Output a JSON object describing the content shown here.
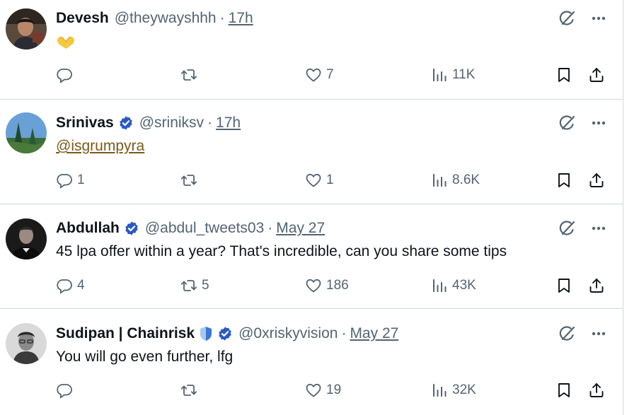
{
  "tweets": [
    {
      "name": "Devesh",
      "verified": false,
      "shield": false,
      "handle": "@theywayshhh",
      "separator": "·",
      "time": "17h",
      "text": "",
      "emoji": "heart-hands",
      "replies": "",
      "retweets": "",
      "likes": "7",
      "views": "11K"
    },
    {
      "name": "Srinivas",
      "verified": true,
      "shield": false,
      "handle": "@sriniksv",
      "separator": "·",
      "time": "17h",
      "mention": "@isgrumpyra",
      "replies": "1",
      "retweets": "",
      "likes": "1",
      "views": "8.6K"
    },
    {
      "name": "Abdullah",
      "verified": true,
      "shield": false,
      "handle": "@abdul_tweets03",
      "separator": "·",
      "time": "May 27",
      "text": "45 lpa offer within a year? That's incredible, can you share some tips",
      "replies": "4",
      "retweets": "5",
      "likes": "186",
      "views": "43K"
    },
    {
      "name": "Sudipan | Chainrisk",
      "verified": true,
      "shield": true,
      "handle": "@0xriskyvision",
      "separator": "·",
      "time": "May 27",
      "text": "You will go even further, lfg",
      "replies": "",
      "retweets": "",
      "likes": "19",
      "views": "32K"
    }
  ],
  "colors": {
    "text": "#0f1419",
    "secondary": "#536471",
    "verified": "#2a59c2",
    "divider": "#cfd9de",
    "mention": "#7a5a18"
  },
  "icons": [
    "reply-icon",
    "retweet-icon",
    "like-icon",
    "views-icon",
    "bookmark-icon",
    "share-icon",
    "grok-icon",
    "more-icon",
    "verified-badge-icon",
    "shield-badge-icon"
  ]
}
